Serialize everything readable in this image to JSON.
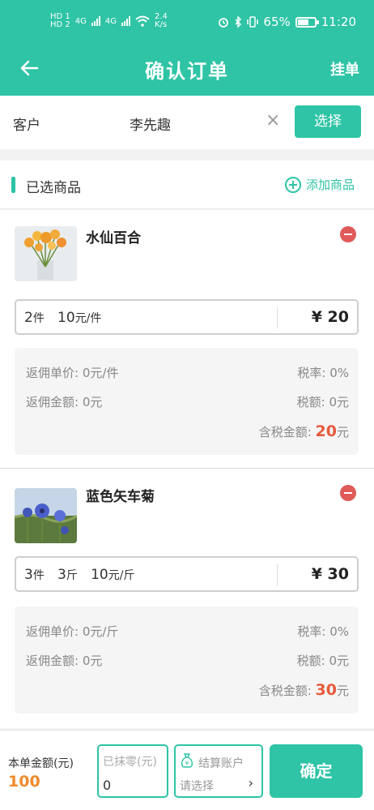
{
  "status_bar": {
    "hd_top": "HD 1",
    "hd_bottom": "HD 2",
    "net1": "4G",
    "net2": "4G",
    "speed": "2.4",
    "speed_unit": "K/s",
    "battery": "65%",
    "battery_level": 0.65,
    "time": "11:20"
  },
  "header": {
    "title": "确认订单",
    "right_action": "挂单"
  },
  "customer": {
    "label": "客户",
    "name": "李先趣",
    "clear_glyph": "×",
    "choose_label": "选择"
  },
  "goods_section": {
    "title": "已选商品",
    "add_label": "添加商品"
  },
  "items": [
    {
      "name": "水仙百合",
      "qty": "2",
      "qty_unit": "件",
      "unit_price": "10",
      "price_unit": "元/件",
      "total": "¥ 20",
      "rebate_price_label": "返佣单价:",
      "rebate_price_value": "0元/件",
      "tax_rate_label": "税率:",
      "tax_rate_value": "0%",
      "rebate_amount_label": "返佣金额:",
      "rebate_amount_value": "0元",
      "tax_label": "税额:",
      "tax_value": "0元",
      "taxed_total_label": "含税金额:",
      "taxed_total_value": "20",
      "taxed_total_unit": "元"
    },
    {
      "name": "蓝色矢车菊",
      "qty": "3",
      "qty_unit": "件",
      "weight": "3",
      "weight_unit": "斤",
      "unit_price": "10",
      "price_unit": "元/斤",
      "total": "¥ 30",
      "rebate_price_label": "返佣单价:",
      "rebate_price_value": "0元/斤",
      "tax_rate_label": "税率:",
      "tax_rate_value": "0%",
      "rebate_amount_label": "返佣金额:",
      "rebate_amount_value": "0元",
      "tax_label": "税额:",
      "tax_value": "0元",
      "taxed_total_label": "含税金额:",
      "taxed_total_value": "30",
      "taxed_total_unit": "元"
    }
  ],
  "footer": {
    "amount_label": "本单金额(元)",
    "amount_value": "100",
    "discount_placeholder": "已抹零(元)",
    "discount_value": "0",
    "account_label": "结算账户",
    "account_placeholder": "请选择",
    "chevron": "›",
    "confirm_label": "确定"
  },
  "colors": {
    "accent": "#2ec4a5",
    "danger": "#e05a5a",
    "amount_orange": "#f08a2c",
    "red_value": "#e55a3c"
  }
}
